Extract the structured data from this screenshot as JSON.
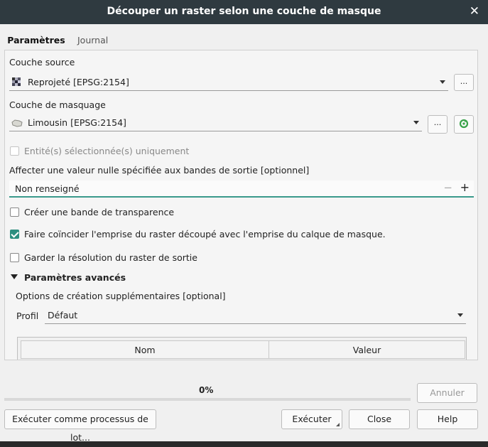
{
  "window": {
    "title": "Découper un raster selon une couche de masque",
    "close_glyph": "✕"
  },
  "tabs": [
    {
      "label": "Paramètres",
      "active": true
    },
    {
      "label": "Journal",
      "active": false
    }
  ],
  "source_layer": {
    "label": "Couche source",
    "value": "Reprojeté [EPSG:2154]",
    "icon": "raster-layer-icon",
    "more": "..."
  },
  "mask_layer": {
    "label": "Couche de masquage",
    "value": "Limousin [EPSG:2154]",
    "icon": "polygon-layer-icon",
    "more": "...",
    "iterate_icon": "iterate-icon"
  },
  "selected_only": {
    "label": "Entité(s) sélectionnée(s) uniquement",
    "checked": false,
    "disabled": true
  },
  "nodata": {
    "label": "Affecter une valeur nulle spécifiée aux bandes de sortie [optionnel]",
    "value": "Non renseigné",
    "minus": "−",
    "plus": "+"
  },
  "alpha_band": {
    "label": "Créer une bande de transparence",
    "checked": false
  },
  "crop_extent": {
    "label": "Faire coïncider l'emprise du raster découpé avec l'emprise du calque de masque.",
    "checked": true
  },
  "keep_resolution": {
    "label": "Garder la résolution du raster de sortie",
    "checked": false
  },
  "advanced": {
    "header": "Paramètres avancés",
    "options_label": "Options de création supplémentaires [optional]",
    "profile_label": "Profil",
    "profile_value": "Défaut",
    "table_headers": [
      "Nom",
      "Valeur"
    ]
  },
  "progress": {
    "text": "0%",
    "value": 0
  },
  "buttons": {
    "cancel": "Annuler",
    "batch": "Exécuter comme processus de lot...",
    "run": "Exécuter",
    "close": "Close",
    "help": "Help"
  },
  "colors": {
    "accent": "#3a9a8c",
    "titlebar": "#2f3a40"
  }
}
